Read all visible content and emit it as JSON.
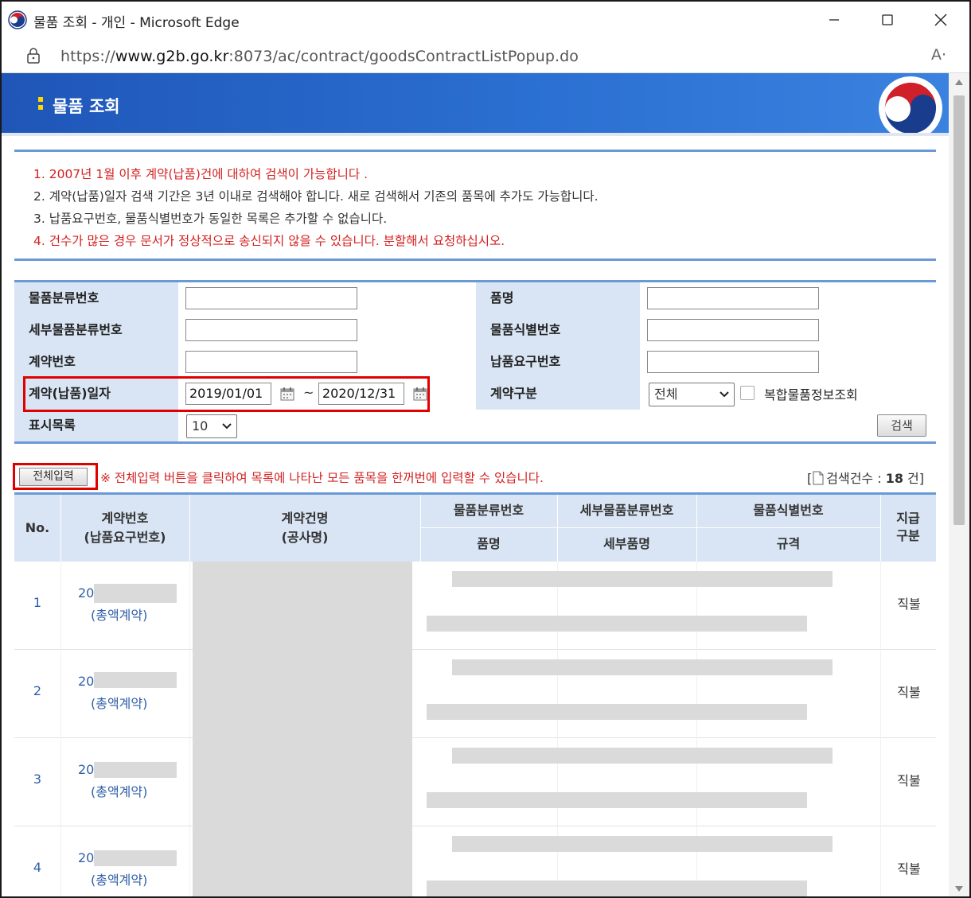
{
  "window": {
    "title": "물품 조회 - 개인 - Microsoft Edge",
    "url_prefix": "https://",
    "url_host": "www.g2b.go.kr",
    "url_rest": ":8073/ac/contract/goodsContractListPopup.do",
    "read_aloud": "A·"
  },
  "banner": {
    "heading": "물품 조회"
  },
  "notices": [
    {
      "text": "1. 2007년 1월 이후 계약(납품)건에 대하여 검색이 가능합니다 .",
      "color": "red"
    },
    {
      "text": "2. 계약(납품)일자 검색 기간은 3년 이내로 검색해야 합니다. 새로 검색해서 기존의 품목에 추가도 가능합니다.",
      "color": "dark"
    },
    {
      "text": "3. 납품요구번호, 물품식별번호가 동일한 목록은 추가할 수 없습니다.",
      "color": "dark"
    },
    {
      "text": "4. 건수가 많은 경우 문서가 정상적으로 송신되지 않을 수 있습니다. 분할해서 요청하십시오.",
      "color": "red"
    }
  ],
  "form": {
    "goods_class_no": {
      "label": "물품분류번호",
      "value": ""
    },
    "item_name": {
      "label": "품명",
      "value": ""
    },
    "detail_class_no": {
      "label": "세부물품분류번호",
      "value": ""
    },
    "goods_id_no": {
      "label": "물품식별번호",
      "value": ""
    },
    "contract_no": {
      "label": "계약번호",
      "value": ""
    },
    "delivery_req_no": {
      "label": "납품요구번호",
      "value": ""
    },
    "contract_date": {
      "label": "계약(납품)일자",
      "from": "2019/01/01",
      "sep": "~",
      "to": "2020/12/31"
    },
    "contract_type": {
      "label": "계약구분",
      "selected": "전체"
    },
    "complex_goods": {
      "label": "복합물품정보조회",
      "checked": false
    },
    "display_count": {
      "label": "표시목록",
      "selected": "10"
    },
    "search_button": "검색"
  },
  "bulk": {
    "button": "전체입력",
    "note": "※ 전체입력 버튼을 클릭하여 목록에 나타난 모든 품목을 한꺼번에 입력할 수 있습니다.",
    "count_label": "검색건수 : ",
    "count_value": "18",
    "count_unit": " 건]",
    "count_open": "["
  },
  "table": {
    "headers": {
      "no": "No.",
      "contract_no": "계약번호",
      "contract_no_sub": "(납품요구번호)",
      "contract_name": "계약건명",
      "contract_name_sub": "(공사명)",
      "goods_class_no": "물품분류번호",
      "detail_class_no": "세부물품분류번호",
      "goods_id_no": "물품식별번호",
      "item_name": "품명",
      "detail_item": "세부품명",
      "spec": "규격",
      "payment": "지급",
      "payment_sub": "구분"
    },
    "rows": [
      {
        "no": "1",
        "contract_prefix": "20",
        "contract_type": "(총액계약)",
        "payment": "직불"
      },
      {
        "no": "2",
        "contract_prefix": "20",
        "contract_type": "(총액계약)",
        "payment": "직불"
      },
      {
        "no": "3",
        "contract_prefix": "20",
        "contract_type": "(총액계약)",
        "payment": "직불"
      },
      {
        "no": "4",
        "contract_prefix": "20",
        "contract_type": "(총액계약)",
        "payment": "직불"
      }
    ]
  },
  "colors": {
    "banner": "#2a6fd1",
    "label_bg": "#d9e5f4",
    "highlight": "#e00000",
    "notice_red": "#d42020",
    "link": "#2f5ea8"
  }
}
